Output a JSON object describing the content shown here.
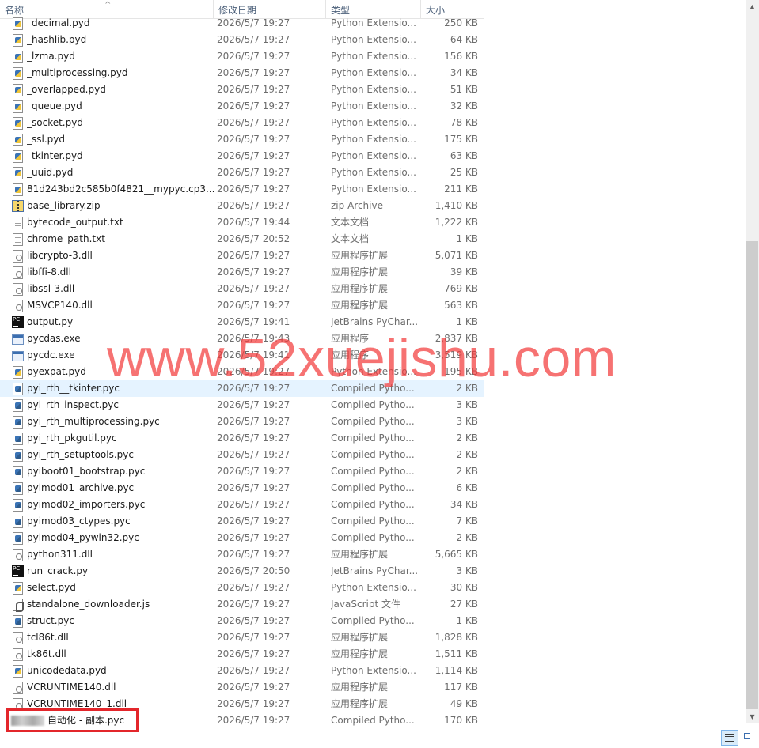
{
  "header": {
    "name": "名称",
    "date": "修改日期",
    "type": "类型",
    "size": "大小",
    "sort_indicator": "^"
  },
  "watermark": "www.52xuejishu.com",
  "files": [
    {
      "name": "_decimal.pyd",
      "date": "2026/5/7 19:27",
      "type": "Python Extensio...",
      "size": "250 KB",
      "icon": "python-extension-icon"
    },
    {
      "name": "_hashlib.pyd",
      "date": "2026/5/7 19:27",
      "type": "Python Extensio...",
      "size": "64 KB",
      "icon": "python-extension-icon"
    },
    {
      "name": "_lzma.pyd",
      "date": "2026/5/7 19:27",
      "type": "Python Extensio...",
      "size": "156 KB",
      "icon": "python-extension-icon"
    },
    {
      "name": "_multiprocessing.pyd",
      "date": "2026/5/7 19:27",
      "type": "Python Extensio...",
      "size": "34 KB",
      "icon": "python-extension-icon"
    },
    {
      "name": "_overlapped.pyd",
      "date": "2026/5/7 19:27",
      "type": "Python Extensio...",
      "size": "51 KB",
      "icon": "python-extension-icon"
    },
    {
      "name": "_queue.pyd",
      "date": "2026/5/7 19:27",
      "type": "Python Extensio...",
      "size": "32 KB",
      "icon": "python-extension-icon"
    },
    {
      "name": "_socket.pyd",
      "date": "2026/5/7 19:27",
      "type": "Python Extensio...",
      "size": "78 KB",
      "icon": "python-extension-icon"
    },
    {
      "name": "_ssl.pyd",
      "date": "2026/5/7 19:27",
      "type": "Python Extensio...",
      "size": "175 KB",
      "icon": "python-extension-icon"
    },
    {
      "name": "_tkinter.pyd",
      "date": "2026/5/7 19:27",
      "type": "Python Extensio...",
      "size": "63 KB",
      "icon": "python-extension-icon"
    },
    {
      "name": "_uuid.pyd",
      "date": "2026/5/7 19:27",
      "type": "Python Extensio...",
      "size": "25 KB",
      "icon": "python-extension-icon"
    },
    {
      "name": "81d243bd2c585b0f4821__mypyc.cp3...",
      "date": "2026/5/7 19:27",
      "type": "Python Extensio...",
      "size": "211 KB",
      "icon": "python-extension-icon"
    },
    {
      "name": "base_library.zip",
      "date": "2026/5/7 19:27",
      "type": "zip Archive",
      "size": "1,410 KB",
      "icon": "zip-archive-icon"
    },
    {
      "name": "bytecode_output.txt",
      "date": "2026/5/7 19:44",
      "type": "文本文档",
      "size": "1,222 KB",
      "icon": "text-document-icon"
    },
    {
      "name": "chrome_path.txt",
      "date": "2026/5/7 20:52",
      "type": "文本文档",
      "size": "1 KB",
      "icon": "text-document-icon"
    },
    {
      "name": "libcrypto-3.dll",
      "date": "2026/5/7 19:27",
      "type": "应用程序扩展",
      "size": "5,071 KB",
      "icon": "dll-file-icon"
    },
    {
      "name": "libffi-8.dll",
      "date": "2026/5/7 19:27",
      "type": "应用程序扩展",
      "size": "39 KB",
      "icon": "dll-file-icon"
    },
    {
      "name": "libssl-3.dll",
      "date": "2026/5/7 19:27",
      "type": "应用程序扩展",
      "size": "769 KB",
      "icon": "dll-file-icon"
    },
    {
      "name": "MSVCP140.dll",
      "date": "2026/5/7 19:27",
      "type": "应用程序扩展",
      "size": "563 KB",
      "icon": "dll-file-icon"
    },
    {
      "name": "output.py",
      "date": "2026/5/7 19:41",
      "type": "JetBrains PyChar...",
      "size": "1 KB",
      "icon": "pycharm-file-icon"
    },
    {
      "name": "pycdas.exe",
      "date": "2026/5/7 19:43",
      "type": "应用程序",
      "size": "2,837 KB",
      "icon": "application-icon"
    },
    {
      "name": "pycdc.exe",
      "date": "2026/5/7 19:41",
      "type": "应用程序",
      "size": "3,519 KB",
      "icon": "application-icon"
    },
    {
      "name": "pyexpat.pyd",
      "date": "2026/5/7 19:27",
      "type": "Python Extensio...",
      "size": "195 KB",
      "icon": "python-extension-icon"
    },
    {
      "name": "pyi_rth__tkinter.pyc",
      "date": "2026/5/7 19:27",
      "type": "Compiled Pytho...",
      "size": "2 KB",
      "icon": "compiled-python-icon",
      "selected": true
    },
    {
      "name": "pyi_rth_inspect.pyc",
      "date": "2026/5/7 19:27",
      "type": "Compiled Pytho...",
      "size": "3 KB",
      "icon": "compiled-python-icon"
    },
    {
      "name": "pyi_rth_multiprocessing.pyc",
      "date": "2026/5/7 19:27",
      "type": "Compiled Pytho...",
      "size": "3 KB",
      "icon": "compiled-python-icon"
    },
    {
      "name": "pyi_rth_pkgutil.pyc",
      "date": "2026/5/7 19:27",
      "type": "Compiled Pytho...",
      "size": "2 KB",
      "icon": "compiled-python-icon"
    },
    {
      "name": "pyi_rth_setuptools.pyc",
      "date": "2026/5/7 19:27",
      "type": "Compiled Pytho...",
      "size": "2 KB",
      "icon": "compiled-python-icon"
    },
    {
      "name": "pyiboot01_bootstrap.pyc",
      "date": "2026/5/7 19:27",
      "type": "Compiled Pytho...",
      "size": "2 KB",
      "icon": "compiled-python-icon"
    },
    {
      "name": "pyimod01_archive.pyc",
      "date": "2026/5/7 19:27",
      "type": "Compiled Pytho...",
      "size": "6 KB",
      "icon": "compiled-python-icon"
    },
    {
      "name": "pyimod02_importers.pyc",
      "date": "2026/5/7 19:27",
      "type": "Compiled Pytho...",
      "size": "34 KB",
      "icon": "compiled-python-icon"
    },
    {
      "name": "pyimod03_ctypes.pyc",
      "date": "2026/5/7 19:27",
      "type": "Compiled Pytho...",
      "size": "7 KB",
      "icon": "compiled-python-icon"
    },
    {
      "name": "pyimod04_pywin32.pyc",
      "date": "2026/5/7 19:27",
      "type": "Compiled Pytho...",
      "size": "2 KB",
      "icon": "compiled-python-icon"
    },
    {
      "name": "python311.dll",
      "date": "2026/5/7 19:27",
      "type": "应用程序扩展",
      "size": "5,665 KB",
      "icon": "dll-file-icon"
    },
    {
      "name": "run_crack.py",
      "date": "2026/5/7 20:50",
      "type": "JetBrains PyChar...",
      "size": "3 KB",
      "icon": "pycharm-file-icon"
    },
    {
      "name": "select.pyd",
      "date": "2026/5/7 19:27",
      "type": "Python Extensio...",
      "size": "30 KB",
      "icon": "python-extension-icon"
    },
    {
      "name": "standalone_downloader.js",
      "date": "2026/5/7 19:27",
      "type": "JavaScript 文件",
      "size": "27 KB",
      "icon": "javascript-file-icon"
    },
    {
      "name": "struct.pyc",
      "date": "2026/5/7 19:27",
      "type": "Compiled Pytho...",
      "size": "1 KB",
      "icon": "compiled-python-icon"
    },
    {
      "name": "tcl86t.dll",
      "date": "2026/5/7 19:27",
      "type": "应用程序扩展",
      "size": "1,828 KB",
      "icon": "dll-file-icon"
    },
    {
      "name": "tk86t.dll",
      "date": "2026/5/7 19:27",
      "type": "应用程序扩展",
      "size": "1,511 KB",
      "icon": "dll-file-icon"
    },
    {
      "name": "unicodedata.pyd",
      "date": "2026/5/7 19:27",
      "type": "Python Extensio...",
      "size": "1,114 KB",
      "icon": "python-extension-icon"
    },
    {
      "name": "VCRUNTIME140.dll",
      "date": "2026/5/7 19:27",
      "type": "应用程序扩展",
      "size": "117 KB",
      "icon": "dll-file-icon"
    },
    {
      "name": "VCRUNTIME140_1.dll",
      "date": "2026/5/7 19:27",
      "type": "应用程序扩展",
      "size": "49 KB",
      "icon": "dll-file-icon"
    },
    {
      "name": "自动化 - 副本.pyc",
      "date": "2026/5/7 19:27",
      "type": "Compiled Pytho...",
      "size": "170 KB",
      "icon": "blurred-icon",
      "blurred_prefix": true
    }
  ],
  "colors": {
    "selected_row": "#e5f3ff",
    "highlight_box": "#e3262b",
    "watermark": "#f23c3c",
    "header_text": "#4c607a"
  }
}
